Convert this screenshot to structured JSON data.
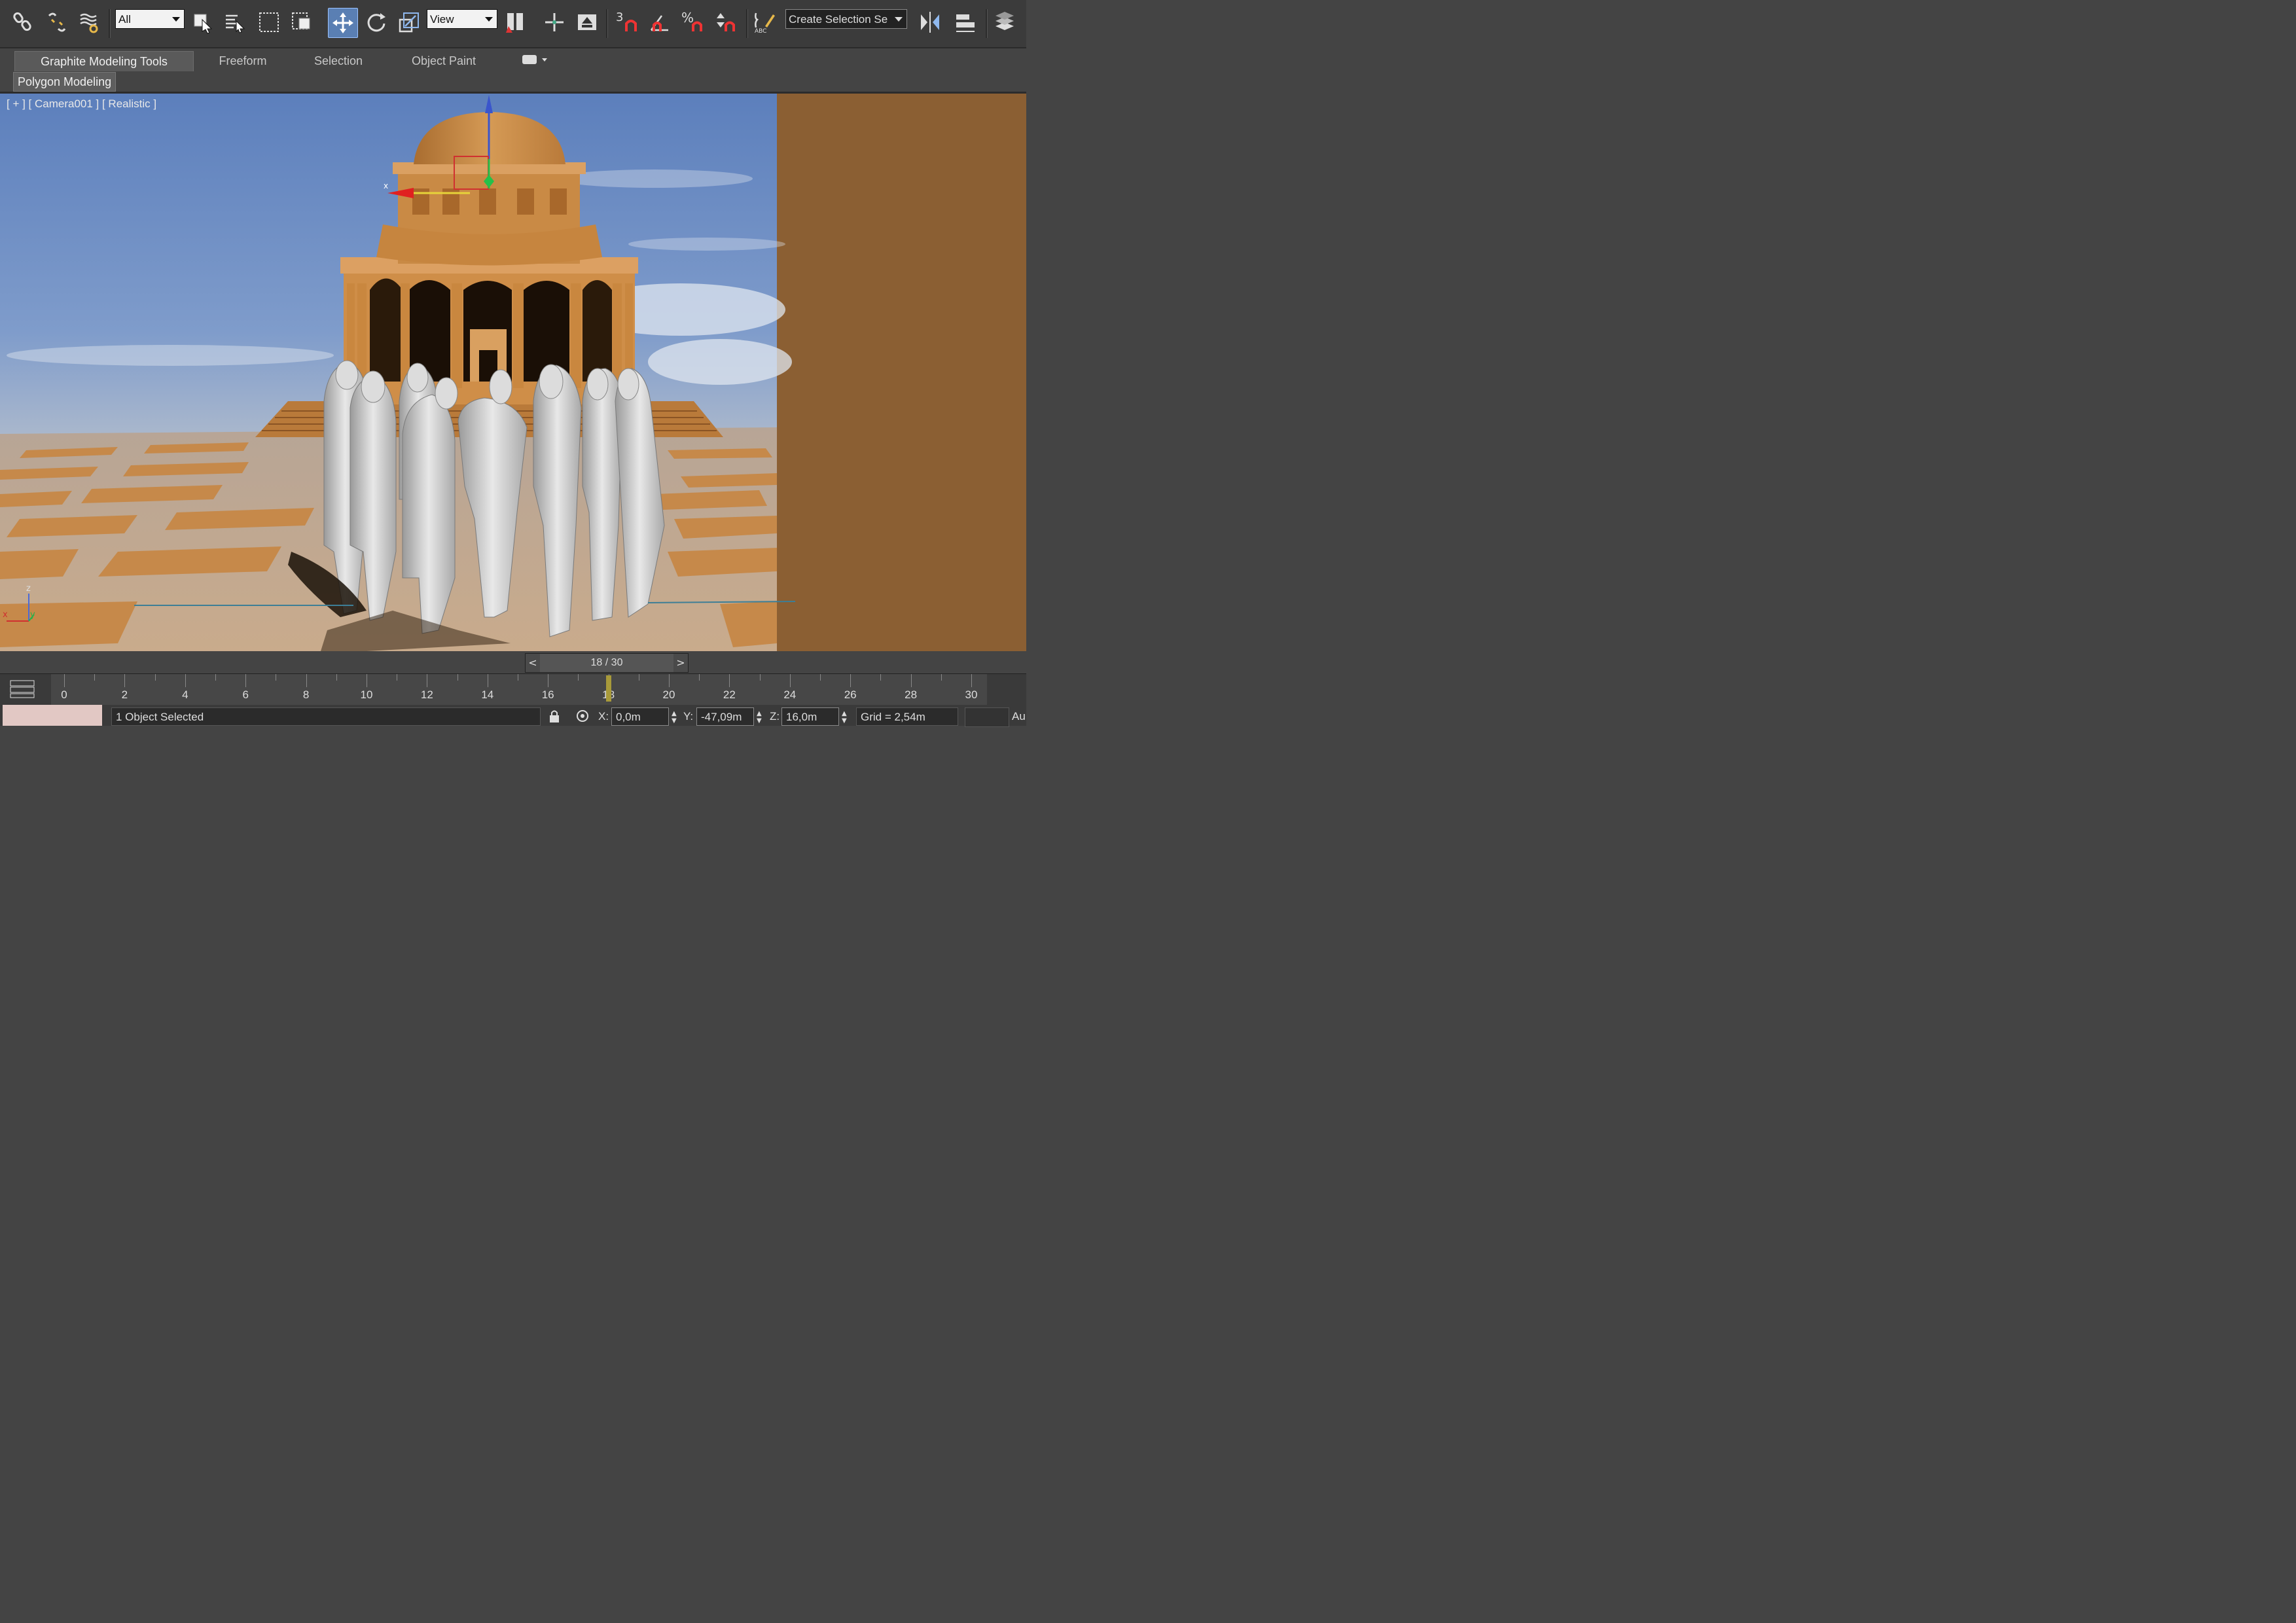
{
  "toolbar": {
    "selection_filter": "All",
    "reference_coord": "View",
    "named_selection": "Create Selection Se",
    "icons": [
      "select-and-link-icon",
      "unlink-icon",
      "bind-space-warp-icon",
      "select-object-icon",
      "select-by-name-icon",
      "rect-selection-icon",
      "window-crossing-icon",
      "select-move-icon",
      "select-rotate-icon",
      "select-scale-icon",
      "use-pivot-icon",
      "select-manipulate-icon",
      "keyboard-shortcut-icon",
      "snap-3d-icon",
      "angle-snap-icon",
      "percent-snap-icon",
      "spinner-snap-icon",
      "edit-named-selection-icon",
      "mirror-icon",
      "align-icon",
      "layer-manager-icon"
    ],
    "snap_label": "3",
    "percent_label": "%",
    "abc_label": "ABC"
  },
  "ribbon": {
    "tabs": [
      "Graphite Modeling Tools",
      "Freeform",
      "Selection",
      "Object Paint"
    ],
    "sub_tab": "Polygon Modeling"
  },
  "viewport": {
    "label": "[ + ] [ Camera001 ] [ Realistic ]",
    "gizmo_axis_x": "x",
    "axis_z": "z",
    "axis_x": "x",
    "axis_y": "y"
  },
  "timeline": {
    "frame_label": "18 / 30",
    "prev": "<",
    "next": ">",
    "current_frame": 18,
    "total_frames": 30,
    "ticks": [
      "0",
      "2",
      "4",
      "6",
      "8",
      "10",
      "12",
      "14",
      "16",
      "18",
      "20",
      "22",
      "24",
      "26",
      "28",
      "30"
    ]
  },
  "status": {
    "message": "1 Object Selected",
    "x_label": "X:",
    "x_value": "0,0m",
    "y_label": "Y:",
    "y_value": "-47,09m",
    "z_label": "Z:",
    "z_value": "16,0m",
    "grid": "Grid = 2,54m",
    "auto": "Au"
  },
  "colors": {
    "sky_top": "#6f8fc4",
    "building": "#cf8e48",
    "ground": "#c6a98a",
    "tiles": "#c68a4a",
    "right_panel": "#8b5f33",
    "active_tool": "#5a7fb3"
  }
}
